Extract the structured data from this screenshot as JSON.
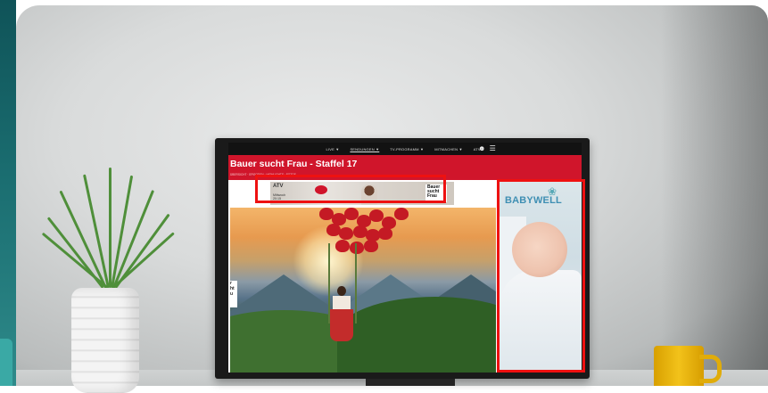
{
  "nav": {
    "items": [
      "LIVE ▼",
      "SENDUNGEN ▼",
      "TV-PROGRAMM ▼",
      "MITMACHEN ▼",
      "ATV 2"
    ],
    "active_index": 1,
    "icons": [
      "user-icon",
      "menu-icon"
    ]
  },
  "header": {
    "title": "Bauer sucht Frau - Staffel 17",
    "subnav": "ÜBERSICHT · EPISODEN · HIGHLIGHTS · FOTOS"
  },
  "ad_banner": {
    "brand": "ATV",
    "date": "Mittwoch\n20:15",
    "logo_text": "Bauer sucht Frau"
  },
  "side_ad": {
    "brand": "BABYWELL"
  },
  "hero": {
    "side_logo": "r\nht\nu"
  },
  "colors": {
    "accent_red": "#d0152b",
    "highlight_red": "#ee1111",
    "side_ad_blue": "#3f8fb3"
  }
}
